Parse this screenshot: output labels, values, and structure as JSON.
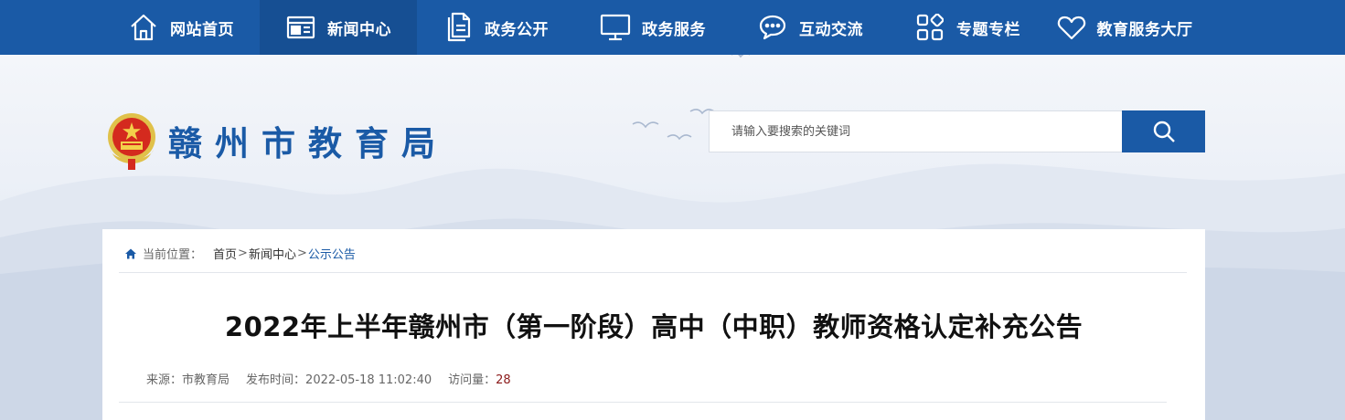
{
  "nav": {
    "items": [
      {
        "label": "网站首页",
        "icon": "home-icon",
        "active": false
      },
      {
        "label": "新闻中心",
        "icon": "news-icon",
        "active": true
      },
      {
        "label": "政务公开",
        "icon": "document-icon",
        "active": false
      },
      {
        "label": "政务服务",
        "icon": "monitor-icon",
        "active": false
      },
      {
        "label": "互动交流",
        "icon": "chat-icon",
        "active": false
      },
      {
        "label": "专题专栏",
        "icon": "grid-icon",
        "active": false
      },
      {
        "label": "教育服务大厅",
        "icon": "heart-icon",
        "active": false
      }
    ]
  },
  "header": {
    "site_title": "赣州市教育局",
    "search": {
      "placeholder": "请输入要搜索的关键词"
    }
  },
  "breadcrumb": {
    "label": "当前位置：",
    "items": [
      "首页",
      "新闻中心",
      "公示公告"
    ],
    "separator": ">"
  },
  "article": {
    "title": "2022年上半年赣州市（第一阶段）高中（中职）教师资格认定补充公告",
    "source_label": "来源：",
    "source": "市教育局",
    "time_label": "发布时间：",
    "time": "2022-05-18 11:02:40",
    "views_label": "访问量：",
    "views": "28"
  },
  "colors": {
    "primary": "#1a5aa6",
    "active_nav": "#164f93",
    "views": "#8b1a1a"
  }
}
